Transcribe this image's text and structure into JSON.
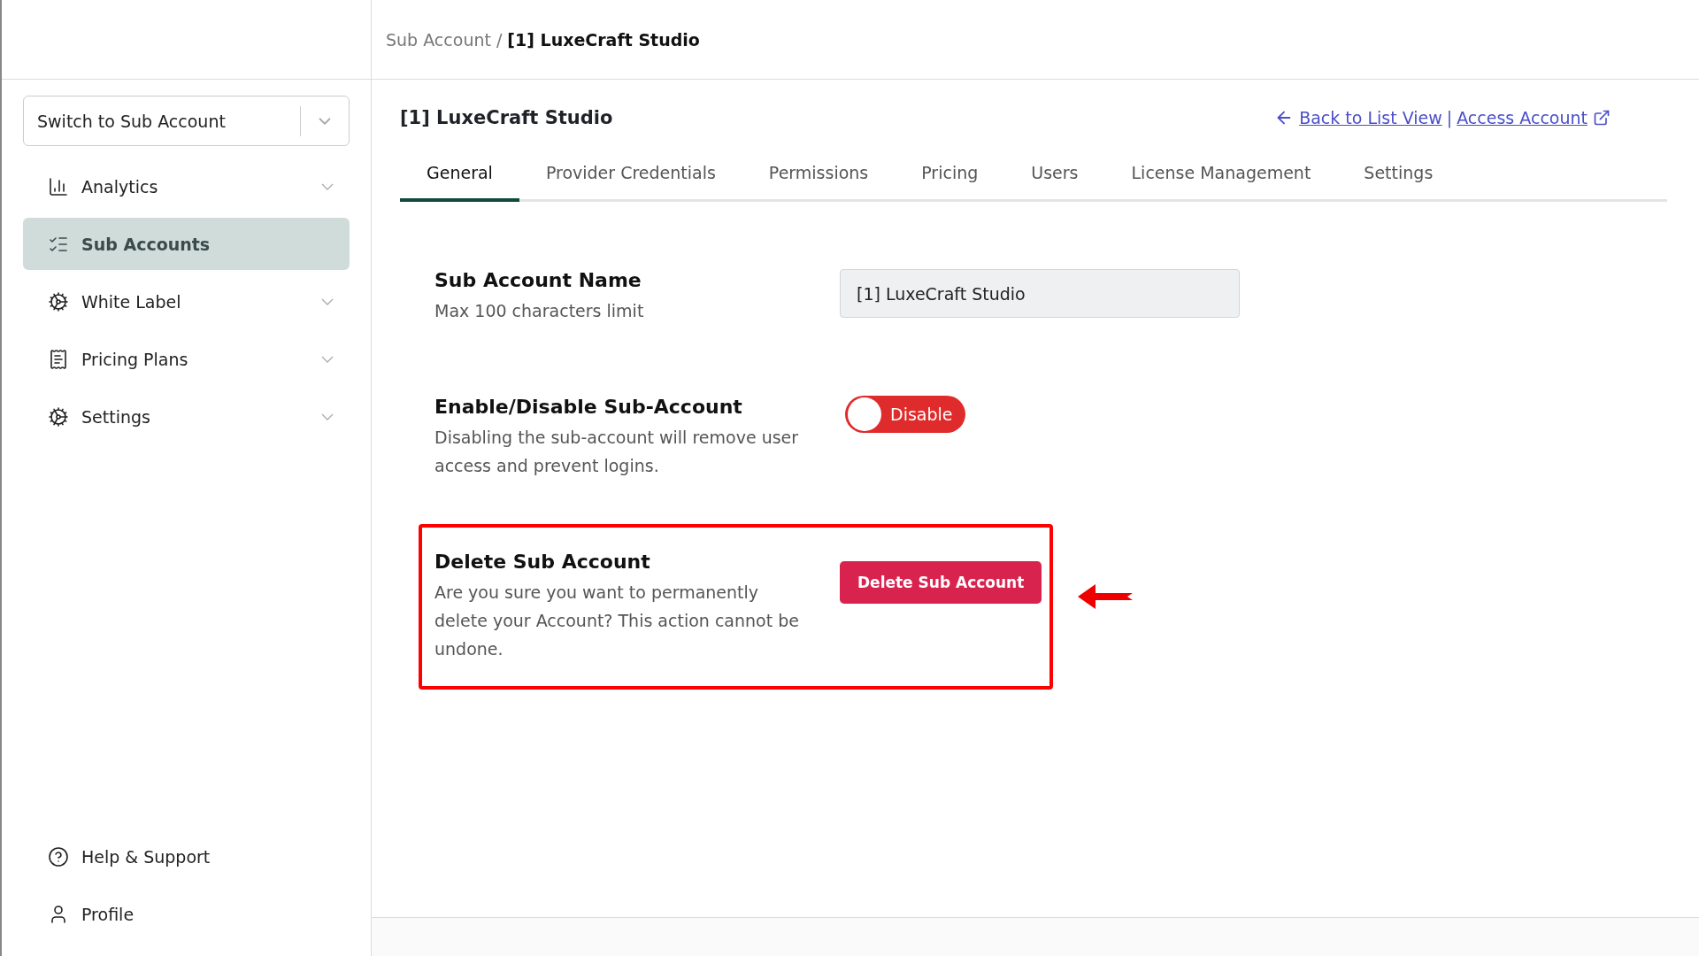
{
  "breadcrumb": {
    "parent": "Sub Account",
    "separator": "/",
    "current": "[1] LuxeCraft Studio"
  },
  "sidebar": {
    "switcher": {
      "placeholder": "Switch to Sub Account"
    },
    "items": [
      {
        "label": "Analytics",
        "selected": false,
        "expandable": true
      },
      {
        "label": "Sub Accounts",
        "selected": true,
        "expandable": false
      },
      {
        "label": "White Label",
        "selected": false,
        "expandable": true
      },
      {
        "label": "Pricing Plans",
        "selected": false,
        "expandable": true
      },
      {
        "label": "Settings",
        "selected": false,
        "expandable": true
      }
    ],
    "footer_items": [
      {
        "label": "Help & Support"
      },
      {
        "label": "Profile"
      }
    ]
  },
  "page": {
    "title": "[1] LuxeCraft Studio",
    "links": [
      {
        "label": "Back to List View",
        "kind": "back"
      },
      {
        "label": "Access Account",
        "kind": "external"
      }
    ],
    "link_separator": "|"
  },
  "tabs": [
    {
      "label": "General",
      "selected": true
    },
    {
      "label": "Provider Credentials",
      "selected": false
    },
    {
      "label": "Permissions",
      "selected": false
    },
    {
      "label": "Pricing",
      "selected": false
    },
    {
      "label": "Users",
      "selected": false
    },
    {
      "label": "License Management",
      "selected": false
    },
    {
      "label": "Settings",
      "selected": false
    }
  ],
  "sections": [
    {
      "kind": "text",
      "title": "Sub Account Name",
      "description": "Max 100 characters limit",
      "value": "[1] LuxeCraft Studio",
      "highlighted": false
    },
    {
      "kind": "toggle",
      "title": "Enable/Disable Sub-Account",
      "description": "Disabling the sub-account will remove user access and prevent logins.",
      "label": "Disable",
      "on": false,
      "highlighted": false
    },
    {
      "kind": "button",
      "title": "Delete Sub Account",
      "description": "Are you sure you want to permanently delete your Account? This action cannot be undone.",
      "label": "Delete Sub Account",
      "highlighted": true
    }
  ]
}
